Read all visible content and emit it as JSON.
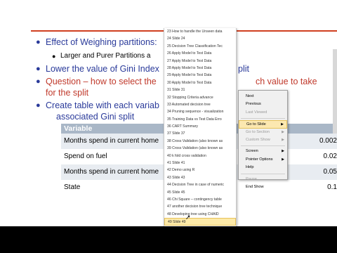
{
  "slide": {
    "bullets": [
      {
        "text": "Effect of Weighing partitions:",
        "color": "blue"
      },
      {
        "text": "Lower the value of Gini Index",
        "tail": "plit",
        "color": "blue"
      },
      {
        "text": "Question – how to select the",
        "tail": "ch value to take",
        "color": "red"
      },
      {
        "text": "for the split",
        "color": "red"
      },
      {
        "text": "Create table with each variab",
        "color": "blue"
      },
      {
        "text": "associated Gini split",
        "color": "blue"
      }
    ],
    "sub_bullet": "Larger and Purer Partitions a",
    "table": {
      "header": "Variable",
      "rows": [
        {
          "variable": "Months spend in current home",
          "gini": "0.002"
        },
        {
          "variable": "Spend on fuel",
          "gini": "0.02"
        },
        {
          "variable": "Months spend in current home",
          "gini": "0.05"
        },
        {
          "variable": "State",
          "gini": "0.1"
        }
      ]
    }
  },
  "slide_list": [
    "23 How to handle the Unseen data",
    "24 Slide 24",
    "25 Decision Tree Classification Tec",
    "26 Apply Model to Test Data",
    "27 Apply Model to Test Data",
    "28 Apply Model to Test Data",
    "29 Apply Model to Test Data",
    "30 Apply Model to Test Data",
    "31 Slide 31",
    "32 Stopping Criteria advance",
    "33 Automated decision tree",
    "34 Pruning sequence - visualization",
    "35 Training Data vs Test Data Erro",
    "36 CART Summary",
    "37 Slide 37",
    "38 Cross Validation (also known as",
    "39 Cross Validation (also known as",
    "40 k fold cross validation",
    "41 Slide 41",
    "42 Demo using R",
    "43 Slide 43",
    "44 Decision Tree in case of numeric",
    "45 Slide 45",
    "46 Chi Square – contingency table",
    "47 another decision tree technique",
    "48 Developing tree using CHAID",
    "49 Slide 49"
  ],
  "context_menu": {
    "items": [
      {
        "label": "Next",
        "state": "normal"
      },
      {
        "label": "Previous",
        "state": "normal"
      },
      {
        "label": "Last Viewed",
        "state": "disabled"
      },
      {
        "sep": true
      },
      {
        "label": "Go to Slide",
        "state": "active",
        "submenu": true
      },
      {
        "label": "Go to Section",
        "state": "disabled",
        "submenu": true
      },
      {
        "label": "Custom Show",
        "state": "disabled",
        "submenu": true
      },
      {
        "sep": true
      },
      {
        "label": "Screen",
        "state": "normal",
        "submenu": true
      },
      {
        "label": "Pointer Options",
        "state": "normal",
        "submenu": true
      },
      {
        "label": "Help",
        "state": "normal"
      },
      {
        "sep": true
      },
      {
        "label": "Pause",
        "state": "disabled"
      },
      {
        "label": "End Show",
        "state": "normal"
      }
    ]
  },
  "colors": {
    "blue": "#2a3a9a",
    "red": "#c0392b",
    "header": "#a9b7c7",
    "highlight": "#fdeaa8"
  }
}
